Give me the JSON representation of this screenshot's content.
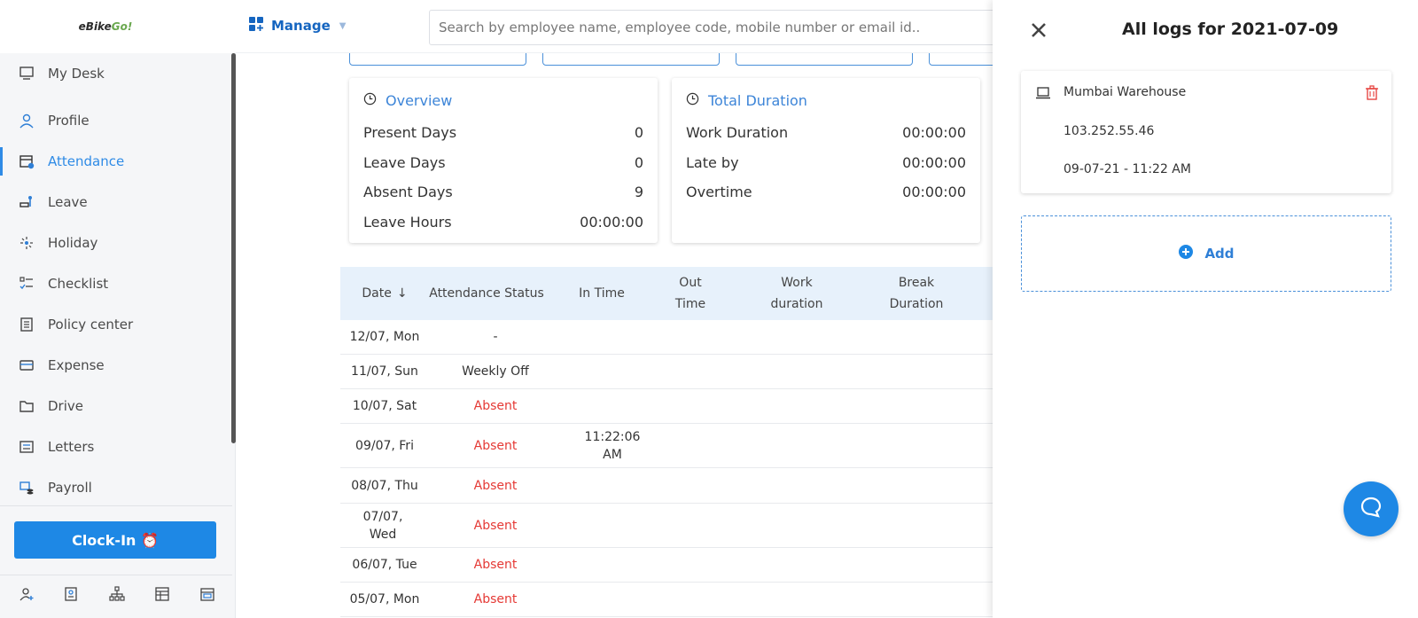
{
  "brand": {
    "logo_text": "eBike",
    "logo_suffix": "Go!"
  },
  "header": {
    "manage_label": "Manage",
    "search_placeholder": "Search by employee name, employee code, mobile number or email id.."
  },
  "sidebar": {
    "items": [
      {
        "label": "My Desk",
        "icon": "desk-icon"
      },
      {
        "label": "Profile",
        "icon": "profile-icon"
      },
      {
        "label": "Attendance",
        "icon": "calendar-icon",
        "active": true
      },
      {
        "label": "Leave",
        "icon": "leave-icon"
      },
      {
        "label": "Holiday",
        "icon": "holiday-icon"
      },
      {
        "label": "Checklist",
        "icon": "checklist-icon"
      },
      {
        "label": "Policy center",
        "icon": "policy-icon"
      },
      {
        "label": "Expense",
        "icon": "expense-icon"
      },
      {
        "label": "Drive",
        "icon": "folder-icon"
      },
      {
        "label": "Letters",
        "icon": "letters-icon"
      },
      {
        "label": "Payroll",
        "icon": "payroll-icon"
      }
    ],
    "clock_in_label": "Clock-In ⏰",
    "bottom_icons": [
      "add-user-icon",
      "id-card-icon",
      "org-chart-icon",
      "table-icon",
      "calendar-grid-icon"
    ]
  },
  "overview": {
    "title": "Overview",
    "rows": [
      {
        "label": "Present Days",
        "value": "0"
      },
      {
        "label": "Leave Days",
        "value": "0"
      },
      {
        "label": "Absent Days",
        "value": "9"
      },
      {
        "label": "Leave Hours",
        "value": "00:00:00"
      }
    ]
  },
  "total_duration": {
    "title": "Total Duration",
    "rows": [
      {
        "label": "Work Duration",
        "value": "00:00:00"
      },
      {
        "label": "Late by",
        "value": "00:00:00"
      },
      {
        "label": "Overtime",
        "value": "00:00:00"
      }
    ]
  },
  "table": {
    "headers": [
      "Date",
      "Attendance Status",
      "In Time",
      "Out Time",
      "Work duration",
      "Break Duration"
    ],
    "rows": [
      {
        "date": "12/07, Mon",
        "status": "-",
        "in_time": "",
        "absent": false
      },
      {
        "date": "11/07, Sun",
        "status": "Weekly Off",
        "in_time": "",
        "absent": false
      },
      {
        "date": "10/07, Sat",
        "status": "Absent",
        "in_time": "",
        "absent": true
      },
      {
        "date": "09/07, Fri",
        "status": "Absent",
        "in_time": "11:22:06 AM",
        "absent": true
      },
      {
        "date": "08/07, Thu",
        "status": "Absent",
        "in_time": "",
        "absent": true
      },
      {
        "date": "07/07, Wed",
        "status": "Absent",
        "in_time": "",
        "absent": true
      },
      {
        "date": "06/07, Tue",
        "status": "Absent",
        "in_time": "",
        "absent": true
      },
      {
        "date": "05/07, Mon",
        "status": "Absent",
        "in_time": "",
        "absent": true
      }
    ]
  },
  "panel": {
    "title": "All logs for 2021-07-09",
    "log": {
      "location": "Mumbai Warehouse",
      "ip": "103.252.55.46",
      "timestamp": "09-07-21 - 11:22 AM"
    },
    "add_label": "Add"
  },
  "colors": {
    "accent": "#1e88e5",
    "absent": "#e53935",
    "table_header_bg": "#e7f1fb"
  }
}
